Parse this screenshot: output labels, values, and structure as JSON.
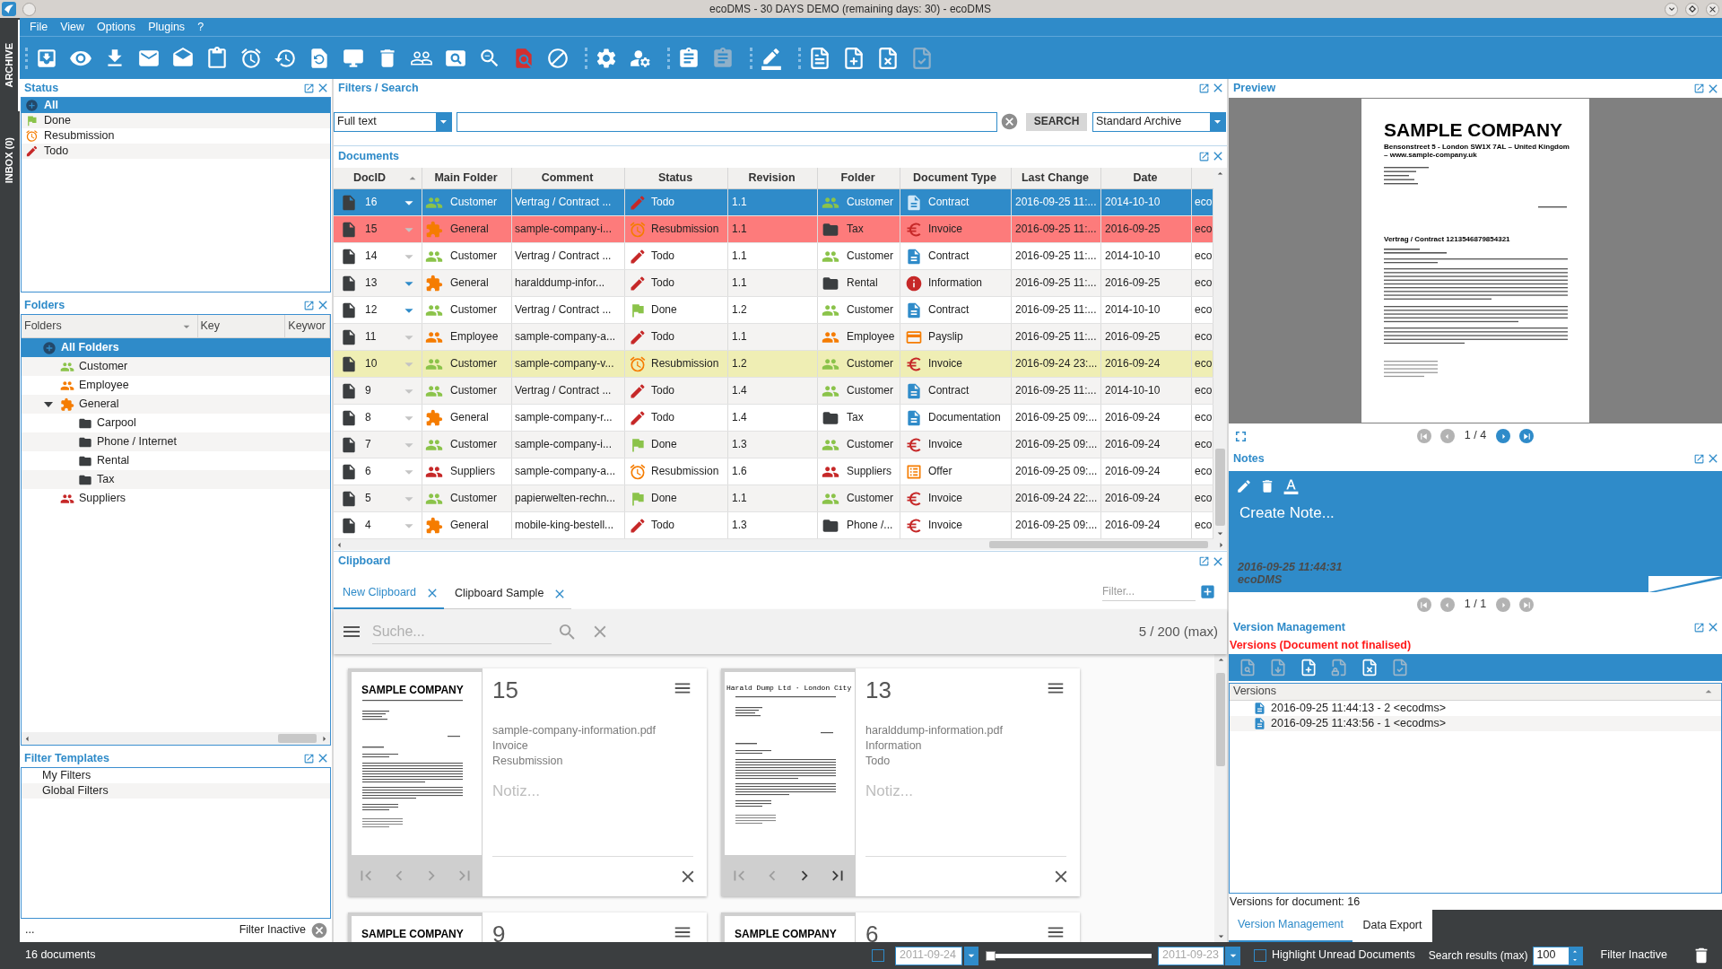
{
  "window": {
    "title": "ecoDMS - 30 DAYS DEMO (remaining days: 30) - ecoDMS"
  },
  "side_tabs": [
    {
      "label": "ARCHIVE",
      "selected": true
    },
    {
      "label": "INBOX (0)",
      "selected": false
    }
  ],
  "menu": [
    "File",
    "View",
    "Options",
    "Plugins",
    "?"
  ],
  "toolbar": [
    {
      "items": [
        {
          "kind": "archive",
          "disabled": false
        },
        {
          "kind": "view",
          "disabled": false
        },
        {
          "kind": "download",
          "disabled": false
        },
        {
          "kind": "mail",
          "disabled": false
        },
        {
          "kind": "mail_open",
          "disabled": false
        },
        {
          "kind": "clipboard",
          "disabled": false
        },
        {
          "kind": "alarm",
          "disabled": false
        },
        {
          "kind": "history",
          "disabled": false
        },
        {
          "kind": "restore",
          "disabled": false
        },
        {
          "kind": "monitor",
          "disabled": false
        },
        {
          "kind": "trash",
          "disabled": false
        },
        {
          "kind": "users",
          "disabled": false
        },
        {
          "kind": "pageview",
          "disabled": false
        },
        {
          "kind": "zoom_out",
          "disabled": false
        },
        {
          "kind": "find",
          "disabled": false
        },
        {
          "kind": "block",
          "disabled": false
        }
      ]
    },
    {
      "items": [
        {
          "kind": "settings",
          "disabled": false
        },
        {
          "kind": "account",
          "disabled": false
        }
      ]
    },
    {
      "items": [
        {
          "kind": "assignment",
          "disabled": false
        },
        {
          "kind": "assignment",
          "disabled": true
        }
      ]
    },
    {
      "items": [
        {
          "kind": "edit",
          "disabled": false
        }
      ]
    },
    {
      "items": [
        {
          "kind": "file_text",
          "disabled": false
        },
        {
          "kind": "file_plus",
          "disabled": false
        },
        {
          "kind": "file_x",
          "disabled": false
        },
        {
          "kind": "file_check",
          "disabled": true
        }
      ]
    }
  ],
  "status_panel": {
    "title": "Status",
    "items": [
      {
        "label": "All",
        "kind": "all",
        "selected": true
      },
      {
        "label": "Done",
        "kind": "done",
        "selected": false
      },
      {
        "label": "Resubmission",
        "kind": "resubmission",
        "selected": false
      },
      {
        "label": "Todo",
        "kind": "todo",
        "selected": false
      }
    ]
  },
  "folders_panel": {
    "title": "Folders",
    "columns": [
      {
        "label": "Folders",
        "sorted": true,
        "descending": true
      },
      {
        "label": "Key",
        "sorted": false
      },
      {
        "label": "Keywor",
        "sorted": false
      }
    ],
    "tree": [
      {
        "label": "All Folders",
        "kind": "all",
        "selected": true,
        "children": [
          {
            "label": "Customer",
            "kind": "people",
            "color": "#8bc34a",
            "selected": false
          },
          {
            "label": "Employee",
            "kind": "people",
            "color": "#f57c00",
            "selected": false
          },
          {
            "label": "General",
            "kind": "puzzle",
            "color": "#f57c00",
            "selected": false,
            "expanded": true,
            "children": [
              {
                "label": "Carpool",
                "kind": "folder",
                "color": "#3b3e40",
                "selected": false
              },
              {
                "label": "Phone / Internet",
                "kind": "folder",
                "color": "#3b3e40",
                "selected": false
              },
              {
                "label": "Rental",
                "kind": "folder",
                "color": "#3b3e40",
                "selected": false
              },
              {
                "label": "Tax",
                "kind": "folder",
                "color": "#3b3e40",
                "selected": false
              }
            ]
          },
          {
            "label": "Suppliers",
            "kind": "people",
            "color": "#c62828",
            "selected": false
          }
        ]
      }
    ]
  },
  "filter_templates": {
    "title": "Filter Templates",
    "items": [
      "My Filters",
      "Global Filters"
    ],
    "more": "...",
    "status": "Filter Inactive"
  },
  "filters": {
    "title": "Filters / Search",
    "mode": "Full text",
    "search_button": "SEARCH",
    "archive": "Standard Archive"
  },
  "documents": {
    "title": "Documents",
    "columns": [
      {
        "label": "DocID",
        "sorted": true,
        "descending": false
      },
      {
        "label": "Main Folder",
        "sorted": false
      },
      {
        "label": "Comment",
        "sorted": false
      },
      {
        "label": "Status",
        "sorted": false
      },
      {
        "label": "Revision",
        "sorted": false
      },
      {
        "label": "Folder",
        "sorted": false
      },
      {
        "label": "Document Type",
        "sorted": false
      },
      {
        "label": "Last Change",
        "sorted": false
      },
      {
        "label": "Date",
        "sorted": false
      }
    ],
    "rows": [
      {
        "doc_id": "16",
        "selected": true,
        "expandable": true,
        "main_folder": {
          "label": "Customer",
          "kind": "people",
          "color": "#8bc34a"
        },
        "comment": "Vertrag / Contract ...",
        "status": {
          "label": "Todo",
          "kind": "todo"
        },
        "revision": "1.1",
        "folder": {
          "label": "Customer",
          "kind": "people",
          "color": "#8bc34a"
        },
        "document_type": {
          "label": "Contract",
          "kind": "document"
        },
        "last_change": "2016-09-25 11:...",
        "date": "2014-10-10",
        "column_10": "eco"
      },
      {
        "doc_id": "15",
        "selected": false,
        "expandable": false,
        "color": "#fd7b7b",
        "main_folder": {
          "label": "General",
          "kind": "puzzle",
          "color": "#f57c00"
        },
        "comment": "sample-company-i...",
        "status": {
          "label": "Resubmission",
          "kind": "resubmission"
        },
        "revision": "1.1",
        "folder": {
          "label": "Tax",
          "kind": "folder",
          "color": "#3b3e40"
        },
        "document_type": {
          "label": "Invoice",
          "kind": "euro"
        },
        "last_change": "2016-09-25 11:...",
        "date": "2016-09-25",
        "column_10": "eco"
      },
      {
        "doc_id": "14",
        "selected": false,
        "expandable": false,
        "main_folder": {
          "label": "Customer",
          "kind": "people",
          "color": "#8bc34a"
        },
        "comment": "Vertrag / Contract ...",
        "status": {
          "label": "Todo",
          "kind": "todo"
        },
        "revision": "1.1",
        "folder": {
          "label": "Customer",
          "kind": "people",
          "color": "#8bc34a"
        },
        "document_type": {
          "label": "Contract",
          "kind": "document"
        },
        "last_change": "2016-09-25 11:...",
        "date": "2014-10-10",
        "column_10": "eco"
      },
      {
        "doc_id": "13",
        "selected": false,
        "expandable": true,
        "main_folder": {
          "label": "General",
          "kind": "puzzle",
          "color": "#f57c00"
        },
        "comment": "haralddump-infor...",
        "status": {
          "label": "Todo",
          "kind": "todo"
        },
        "revision": "1.1",
        "folder": {
          "label": "Rental",
          "kind": "folder",
          "color": "#3b3e40"
        },
        "document_type": {
          "label": "Information",
          "kind": "info"
        },
        "last_change": "2016-09-25 11:...",
        "date": "2016-09-25",
        "column_10": "eco"
      },
      {
        "doc_id": "12",
        "selected": false,
        "expandable": true,
        "main_folder": {
          "label": "Customer",
          "kind": "people",
          "color": "#8bc34a"
        },
        "comment": "Vertrag / Contract ...",
        "status": {
          "label": "Done",
          "kind": "done"
        },
        "revision": "1.2",
        "folder": {
          "label": "Customer",
          "kind": "people",
          "color": "#8bc34a"
        },
        "document_type": {
          "label": "Contract",
          "kind": "document"
        },
        "last_change": "2016-09-25 11:...",
        "date": "2014-10-10",
        "column_10": "eco"
      },
      {
        "doc_id": "11",
        "selected": false,
        "expandable": false,
        "main_folder": {
          "label": "Employee",
          "kind": "people",
          "color": "#f57c00"
        },
        "comment": "sample-company-a...",
        "status": {
          "label": "Todo",
          "kind": "todo"
        },
        "revision": "1.1",
        "folder": {
          "label": "Employee",
          "kind": "people",
          "color": "#f57c00"
        },
        "document_type": {
          "label": "Payslip",
          "kind": "card"
        },
        "last_change": "2016-09-25 11:...",
        "date": "2016-09-25",
        "column_10": "eco"
      },
      {
        "doc_id": "10",
        "selected": false,
        "expandable": false,
        "color": "#efeeb4",
        "main_folder": {
          "label": "Customer",
          "kind": "people",
          "color": "#8bc34a"
        },
        "comment": "sample-company-v...",
        "status": {
          "label": "Resubmission",
          "kind": "resubmission"
        },
        "revision": "1.2",
        "folder": {
          "label": "Customer",
          "kind": "people",
          "color": "#8bc34a"
        },
        "document_type": {
          "label": "Invoice",
          "kind": "euro"
        },
        "last_change": "2016-09-24 23:...",
        "date": "2016-09-24",
        "column_10": "eco"
      },
      {
        "doc_id": "9",
        "selected": false,
        "expandable": false,
        "main_folder": {
          "label": "Customer",
          "kind": "people",
          "color": "#8bc34a"
        },
        "comment": "Vertrag / Contract ...",
        "status": {
          "label": "Todo",
          "kind": "todo"
        },
        "revision": "1.4",
        "folder": {
          "label": "Customer",
          "kind": "people",
          "color": "#8bc34a"
        },
        "document_type": {
          "label": "Contract",
          "kind": "document"
        },
        "last_change": "2016-09-25 11:...",
        "date": "2014-10-10",
        "column_10": "eco"
      },
      {
        "doc_id": "8",
        "selected": false,
        "expandable": false,
        "main_folder": {
          "label": "General",
          "kind": "puzzle",
          "color": "#f57c00"
        },
        "comment": "sample-company-r...",
        "status": {
          "label": "Todo",
          "kind": "todo"
        },
        "revision": "1.4",
        "folder": {
          "label": "Tax",
          "kind": "folder",
          "color": "#3b3e40"
        },
        "document_type": {
          "label": "Documentation",
          "kind": "document"
        },
        "last_change": "2016-09-25 09:...",
        "date": "2016-09-24",
        "column_10": "eco"
      },
      {
        "doc_id": "7",
        "selected": false,
        "expandable": false,
        "main_folder": {
          "label": "Customer",
          "kind": "people",
          "color": "#8bc34a"
        },
        "comment": "sample-company-i...",
        "status": {
          "label": "Done",
          "kind": "done"
        },
        "revision": "1.3",
        "folder": {
          "label": "Customer",
          "kind": "people",
          "color": "#8bc34a"
        },
        "document_type": {
          "label": "Invoice",
          "kind": "euro"
        },
        "last_change": "2016-09-25 09:...",
        "date": "2016-09-24",
        "column_10": "eco"
      },
      {
        "doc_id": "6",
        "selected": false,
        "expandable": false,
        "main_folder": {
          "label": "Suppliers",
          "kind": "people",
          "color": "#c62828"
        },
        "comment": "sample-company-a...",
        "status": {
          "label": "Resubmission",
          "kind": "resubmission"
        },
        "revision": "1.6",
        "folder": {
          "label": "Suppliers",
          "kind": "people",
          "color": "#c62828"
        },
        "document_type": {
          "label": "Offer",
          "kind": "list"
        },
        "last_change": "2016-09-25 09:...",
        "date": "2016-09-24",
        "column_10": "eco"
      },
      {
        "doc_id": "5",
        "selected": false,
        "expandable": false,
        "main_folder": {
          "label": "Customer",
          "kind": "people",
          "color": "#8bc34a"
        },
        "comment": "papierwelten-rechn...",
        "status": {
          "label": "Done",
          "kind": "done"
        },
        "revision": "1.1",
        "folder": {
          "label": "Customer",
          "kind": "people",
          "color": "#8bc34a"
        },
        "document_type": {
          "label": "Invoice",
          "kind": "euro"
        },
        "last_change": "2016-09-24 22:...",
        "date": "2016-09-24",
        "column_10": "eco"
      },
      {
        "doc_id": "4",
        "selected": false,
        "expandable": false,
        "main_folder": {
          "label": "General",
          "kind": "puzzle",
          "color": "#f57c00"
        },
        "comment": "mobile-king-bestell...",
        "status": {
          "label": "Todo",
          "kind": "todo"
        },
        "revision": "1.3",
        "folder": {
          "label": "Phone /...",
          "kind": "folder",
          "color": "#3b3e40"
        },
        "document_type": {
          "label": "Invoice",
          "kind": "euro"
        },
        "last_change": "2016-09-25 09:...",
        "date": "2016-09-24",
        "column_10": "eco"
      }
    ]
  },
  "clipboard": {
    "title": "Clipboard",
    "tabs": [
      {
        "label": "New Clipboard",
        "selected": true
      },
      {
        "label": "Clipboard Sample",
        "selected": false
      }
    ],
    "filter": {
      "placeholder": "Filter..."
    },
    "search": {
      "placeholder": "Suche..."
    },
    "count": "5 / 200 (max)",
    "cards": [
      {
        "number": "15",
        "thumb": {
          "kind": "letterhead",
          "heading": "SAMPLE COMPANY"
        },
        "file": "sample-company-information.pdf",
        "type": "Invoice",
        "status": "Resubmission",
        "note": {
          "placeholder": "Notiz..."
        },
        "nav": [
          {
            "kind": "first",
            "disabled": true
          },
          {
            "kind": "prev",
            "disabled": true
          },
          {
            "kind": "next",
            "disabled": true
          },
          {
            "kind": "last",
            "disabled": true
          }
        ]
      },
      {
        "number": "13",
        "thumb": {
          "kind": "typewriter",
          "heading": "Harald Dump Ltd · London City"
        },
        "file": "haralddump-information.pdf",
        "type": "Information",
        "status": "Todo",
        "note": {
          "placeholder": "Notiz..."
        },
        "nav": [
          {
            "kind": "first",
            "disabled": true
          },
          {
            "kind": "prev",
            "disabled": true
          },
          {
            "kind": "next",
            "disabled": false
          },
          {
            "kind": "last",
            "disabled": false
          }
        ]
      },
      {
        "number": "9",
        "thumb": {
          "kind": "letterhead",
          "heading": "SAMPLE COMPANY"
        }
      },
      {
        "number": "6",
        "thumb": {
          "kind": "letterhead",
          "heading": "SAMPLE COMPANY"
        }
      }
    ]
  },
  "preview": {
    "title": "Preview",
    "page": {
      "heading": "SAMPLE COMPANY",
      "address": "Bensonstreet 5 - London SW1X 7AL – United Kingdom – www.sample-company.uk",
      "subject": "Vertrag / Contract 1213546879854321"
    },
    "pager": "1 / 4",
    "nav": [
      {
        "kind": "first",
        "disabled": true
      },
      {
        "kind": "prev",
        "disabled": true
      },
      {
        "kind": "next",
        "disabled": false
      },
      {
        "kind": "last",
        "disabled": false
      }
    ]
  },
  "notes": {
    "title": "Notes",
    "placeholder": "Create Note...",
    "timestamp": "2016-09-25 11:44:31",
    "author": "ecoDMS",
    "pager": "1 / 1",
    "nav": [
      {
        "kind": "first",
        "disabled": true
      },
      {
        "kind": "prev",
        "disabled": true
      },
      {
        "kind": "next",
        "disabled": true
      },
      {
        "kind": "last",
        "disabled": true
      }
    ]
  },
  "version_management": {
    "title": "Version Management",
    "warning": "Versions (Document not finalised)",
    "tools": [
      {
        "kind": "view",
        "disabled": true
      },
      {
        "kind": "download",
        "disabled": true
      },
      {
        "kind": "add",
        "disabled": false
      },
      {
        "kind": "lock",
        "disabled": true
      },
      {
        "kind": "remove",
        "disabled": false
      },
      {
        "kind": "finalise",
        "disabled": true
      }
    ],
    "column": {
      "label": "Versions",
      "sorted": true,
      "descending": false
    },
    "versions": [
      {
        "label": "2016-09-25 11:44:13 - 2 <ecodms>",
        "selected": false
      },
      {
        "label": "2016-09-25 11:43:56 - 1 <ecodms>",
        "selected": false
      }
    ],
    "footer": "Versions for document: 16",
    "tabs": [
      {
        "label": "Version Management",
        "selected": true
      },
      {
        "label": "Data Export",
        "selected": false
      }
    ]
  },
  "bottom_bar": {
    "document_count": "16 documents",
    "date_filter": {
      "checked": false,
      "from": "2011-09-24",
      "to": "2011-09-23",
      "level": 0
    },
    "highlight_unread": {
      "label": "Highlight Unread Documents",
      "checked": false
    },
    "search_results": {
      "label": "Search results (max)",
      "value": "100"
    },
    "filter_status": "Filter Inactive"
  }
}
